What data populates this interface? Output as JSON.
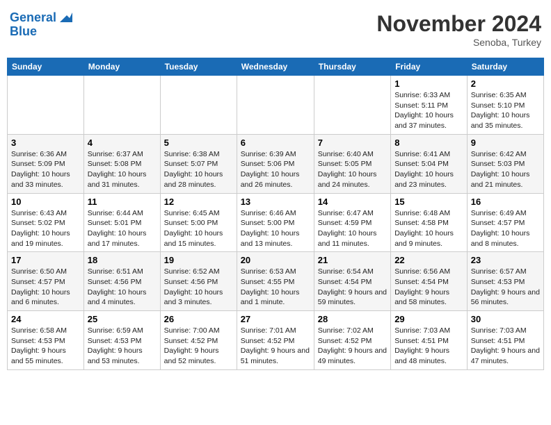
{
  "header": {
    "logo_line1": "General",
    "logo_line2": "Blue",
    "month_title": "November 2024",
    "subtitle": "Senoba, Turkey"
  },
  "weekdays": [
    "Sunday",
    "Monday",
    "Tuesday",
    "Wednesday",
    "Thursday",
    "Friday",
    "Saturday"
  ],
  "weeks": [
    [
      {
        "day": "",
        "sunrise": "",
        "sunset": "",
        "daylight": ""
      },
      {
        "day": "",
        "sunrise": "",
        "sunset": "",
        "daylight": ""
      },
      {
        "day": "",
        "sunrise": "",
        "sunset": "",
        "daylight": ""
      },
      {
        "day": "",
        "sunrise": "",
        "sunset": "",
        "daylight": ""
      },
      {
        "day": "",
        "sunrise": "",
        "sunset": "",
        "daylight": ""
      },
      {
        "day": "1",
        "sunrise": "Sunrise: 6:33 AM",
        "sunset": "Sunset: 5:11 PM",
        "daylight": "Daylight: 10 hours and 37 minutes."
      },
      {
        "day": "2",
        "sunrise": "Sunrise: 6:35 AM",
        "sunset": "Sunset: 5:10 PM",
        "daylight": "Daylight: 10 hours and 35 minutes."
      }
    ],
    [
      {
        "day": "3",
        "sunrise": "Sunrise: 6:36 AM",
        "sunset": "Sunset: 5:09 PM",
        "daylight": "Daylight: 10 hours and 33 minutes."
      },
      {
        "day": "4",
        "sunrise": "Sunrise: 6:37 AM",
        "sunset": "Sunset: 5:08 PM",
        "daylight": "Daylight: 10 hours and 31 minutes."
      },
      {
        "day": "5",
        "sunrise": "Sunrise: 6:38 AM",
        "sunset": "Sunset: 5:07 PM",
        "daylight": "Daylight: 10 hours and 28 minutes."
      },
      {
        "day": "6",
        "sunrise": "Sunrise: 6:39 AM",
        "sunset": "Sunset: 5:06 PM",
        "daylight": "Daylight: 10 hours and 26 minutes."
      },
      {
        "day": "7",
        "sunrise": "Sunrise: 6:40 AM",
        "sunset": "Sunset: 5:05 PM",
        "daylight": "Daylight: 10 hours and 24 minutes."
      },
      {
        "day": "8",
        "sunrise": "Sunrise: 6:41 AM",
        "sunset": "Sunset: 5:04 PM",
        "daylight": "Daylight: 10 hours and 23 minutes."
      },
      {
        "day": "9",
        "sunrise": "Sunrise: 6:42 AM",
        "sunset": "Sunset: 5:03 PM",
        "daylight": "Daylight: 10 hours and 21 minutes."
      }
    ],
    [
      {
        "day": "10",
        "sunrise": "Sunrise: 6:43 AM",
        "sunset": "Sunset: 5:02 PM",
        "daylight": "Daylight: 10 hours and 19 minutes."
      },
      {
        "day": "11",
        "sunrise": "Sunrise: 6:44 AM",
        "sunset": "Sunset: 5:01 PM",
        "daylight": "Daylight: 10 hours and 17 minutes."
      },
      {
        "day": "12",
        "sunrise": "Sunrise: 6:45 AM",
        "sunset": "Sunset: 5:00 PM",
        "daylight": "Daylight: 10 hours and 15 minutes."
      },
      {
        "day": "13",
        "sunrise": "Sunrise: 6:46 AM",
        "sunset": "Sunset: 5:00 PM",
        "daylight": "Daylight: 10 hours and 13 minutes."
      },
      {
        "day": "14",
        "sunrise": "Sunrise: 6:47 AM",
        "sunset": "Sunset: 4:59 PM",
        "daylight": "Daylight: 10 hours and 11 minutes."
      },
      {
        "day": "15",
        "sunrise": "Sunrise: 6:48 AM",
        "sunset": "Sunset: 4:58 PM",
        "daylight": "Daylight: 10 hours and 9 minutes."
      },
      {
        "day": "16",
        "sunrise": "Sunrise: 6:49 AM",
        "sunset": "Sunset: 4:57 PM",
        "daylight": "Daylight: 10 hours and 8 minutes."
      }
    ],
    [
      {
        "day": "17",
        "sunrise": "Sunrise: 6:50 AM",
        "sunset": "Sunset: 4:57 PM",
        "daylight": "Daylight: 10 hours and 6 minutes."
      },
      {
        "day": "18",
        "sunrise": "Sunrise: 6:51 AM",
        "sunset": "Sunset: 4:56 PM",
        "daylight": "Daylight: 10 hours and 4 minutes."
      },
      {
        "day": "19",
        "sunrise": "Sunrise: 6:52 AM",
        "sunset": "Sunset: 4:56 PM",
        "daylight": "Daylight: 10 hours and 3 minutes."
      },
      {
        "day": "20",
        "sunrise": "Sunrise: 6:53 AM",
        "sunset": "Sunset: 4:55 PM",
        "daylight": "Daylight: 10 hours and 1 minute."
      },
      {
        "day": "21",
        "sunrise": "Sunrise: 6:54 AM",
        "sunset": "Sunset: 4:54 PM",
        "daylight": "Daylight: 9 hours and 59 minutes."
      },
      {
        "day": "22",
        "sunrise": "Sunrise: 6:56 AM",
        "sunset": "Sunset: 4:54 PM",
        "daylight": "Daylight: 9 hours and 58 minutes."
      },
      {
        "day": "23",
        "sunrise": "Sunrise: 6:57 AM",
        "sunset": "Sunset: 4:53 PM",
        "daylight": "Daylight: 9 hours and 56 minutes."
      }
    ],
    [
      {
        "day": "24",
        "sunrise": "Sunrise: 6:58 AM",
        "sunset": "Sunset: 4:53 PM",
        "daylight": "Daylight: 9 hours and 55 minutes."
      },
      {
        "day": "25",
        "sunrise": "Sunrise: 6:59 AM",
        "sunset": "Sunset: 4:53 PM",
        "daylight": "Daylight: 9 hours and 53 minutes."
      },
      {
        "day": "26",
        "sunrise": "Sunrise: 7:00 AM",
        "sunset": "Sunset: 4:52 PM",
        "daylight": "Daylight: 9 hours and 52 minutes."
      },
      {
        "day": "27",
        "sunrise": "Sunrise: 7:01 AM",
        "sunset": "Sunset: 4:52 PM",
        "daylight": "Daylight: 9 hours and 51 minutes."
      },
      {
        "day": "28",
        "sunrise": "Sunrise: 7:02 AM",
        "sunset": "Sunset: 4:52 PM",
        "daylight": "Daylight: 9 hours and 49 minutes."
      },
      {
        "day": "29",
        "sunrise": "Sunrise: 7:03 AM",
        "sunset": "Sunset: 4:51 PM",
        "daylight": "Daylight: 9 hours and 48 minutes."
      },
      {
        "day": "30",
        "sunrise": "Sunrise: 7:03 AM",
        "sunset": "Sunset: 4:51 PM",
        "daylight": "Daylight: 9 hours and 47 minutes."
      }
    ]
  ]
}
